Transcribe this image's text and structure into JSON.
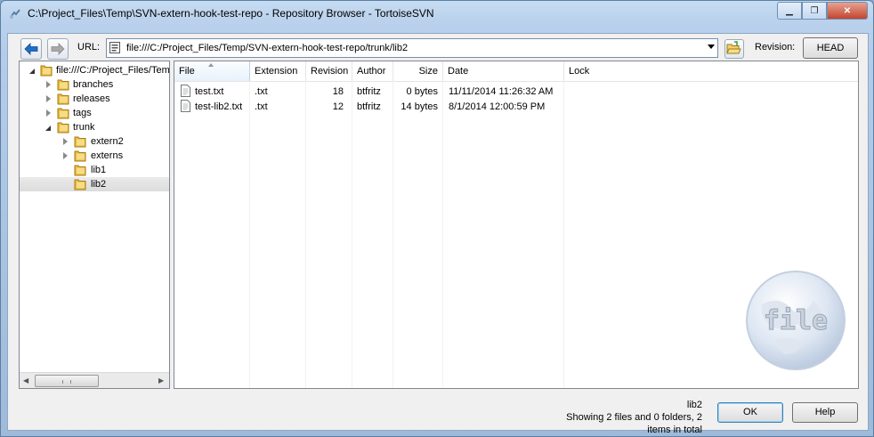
{
  "window": {
    "title": "C:\\Project_Files\\Temp\\SVN-extern-hook-test-repo - Repository Browser - TortoiseSVN",
    "minimize_symbol": "▁",
    "maximize_symbol": "❐",
    "close_symbol": "✕"
  },
  "toolbar": {
    "url_label": "URL:",
    "url_value": "file:///C:/Project_Files/Temp/SVN-extern-hook-test-repo/trunk/lib2",
    "revision_label": "Revision:",
    "revision_value": "HEAD",
    "back_icon": "back-arrow-icon",
    "forward_icon": "forward-arrow-icon"
  },
  "tree": {
    "root": "file:///C:/Project_Files/Temp/SVN-extern-hook-test-repo",
    "items": [
      {
        "label": "branches"
      },
      {
        "label": "releases"
      },
      {
        "label": "tags"
      },
      {
        "label": "trunk"
      },
      {
        "label": "extern2"
      },
      {
        "label": "externs"
      },
      {
        "label": "lib1"
      },
      {
        "label": "lib2"
      }
    ],
    "selected": "lib2",
    "scroll_left": "◀",
    "scroll_right": "▶"
  },
  "files": {
    "columns": [
      "File",
      "Extension",
      "Revision",
      "Author",
      "Size",
      "Date",
      "Lock"
    ],
    "sorted_column": "File",
    "rows": [
      {
        "file": "test.txt",
        "extension": ".txt",
        "revision": "18",
        "author": "btfritz",
        "size": "0 bytes",
        "date": "11/11/2014 11:26:32 AM",
        "lock": ""
      },
      {
        "file": "test-lib2.txt",
        "extension": ".txt",
        "revision": "12",
        "author": "btfritz",
        "size": "14 bytes",
        "date": "8/1/2014 12:00:59 PM",
        "lock": ""
      }
    ],
    "watermark_text": "file"
  },
  "status": {
    "current": "lib2",
    "summary": "Showing 2 files and 0 folders, 2 items in total"
  },
  "buttons": {
    "ok": "OK",
    "help": "Help"
  },
  "colors": {
    "selection": "#dcdcdc",
    "folder": "#e8b93a",
    "accent": "#1f6fc5"
  }
}
